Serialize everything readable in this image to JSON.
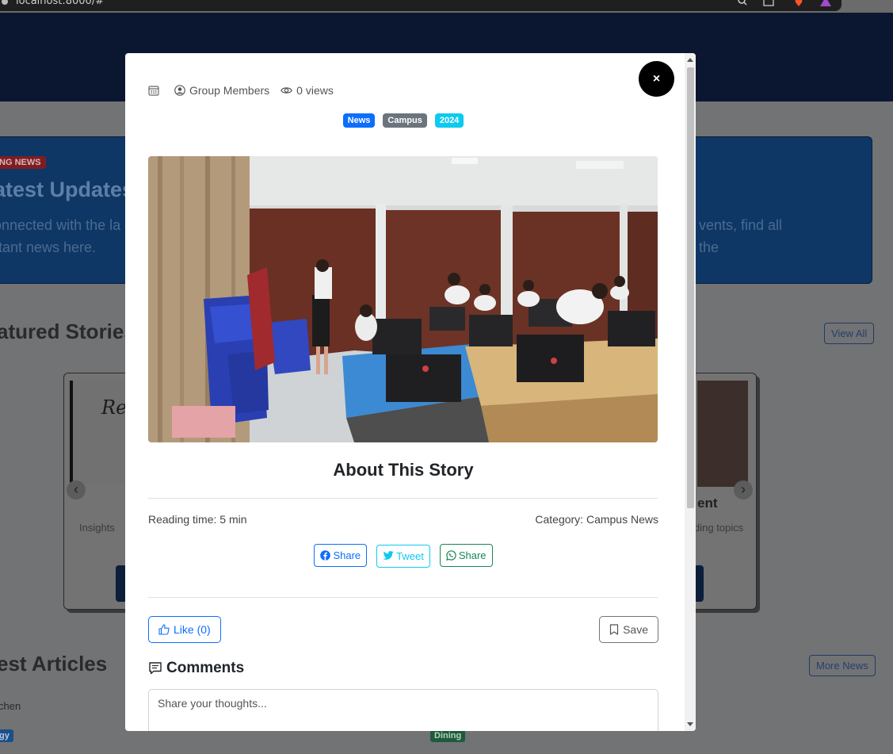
{
  "browser": {
    "url": "localhost:8000/#"
  },
  "background": {
    "breaking_badge": "ING NEWS",
    "hero_title": "atest Updates",
    "hero_text_1": "onnected with the la",
    "hero_text_1b": "vents, find all the",
    "hero_text_2": "rtant news here.",
    "featured_title": "atured Stories",
    "view_all": "View All",
    "carousel_left_text": "Insights",
    "carousel_right_title": "ent",
    "carousel_right_text": "ding topics",
    "latest_title": "est Articles",
    "more_news": "More News",
    "author": "chen",
    "tag_left": "gy",
    "tag_right": "Dining",
    "handwriting": "Re"
  },
  "modal": {
    "close_label": "×",
    "meta": {
      "author": "Group Members",
      "views": "0 views"
    },
    "tags": [
      {
        "label": "News",
        "color": "#0d6efd"
      },
      {
        "label": "Campus",
        "color": "#6c757d"
      },
      {
        "label": "2024",
        "color": "#0dcaf0"
      }
    ],
    "about_title": "About This Story",
    "reading_time": "Reading time: 5 min",
    "category": "Category: Campus News",
    "share": {
      "facebook": "Share",
      "twitter": "Tweet",
      "whatsapp": "Share"
    },
    "like_label": "Like (0)",
    "save_label": "Save",
    "comments_title": "Comments",
    "comment_placeholder": "Share your thoughts..."
  }
}
